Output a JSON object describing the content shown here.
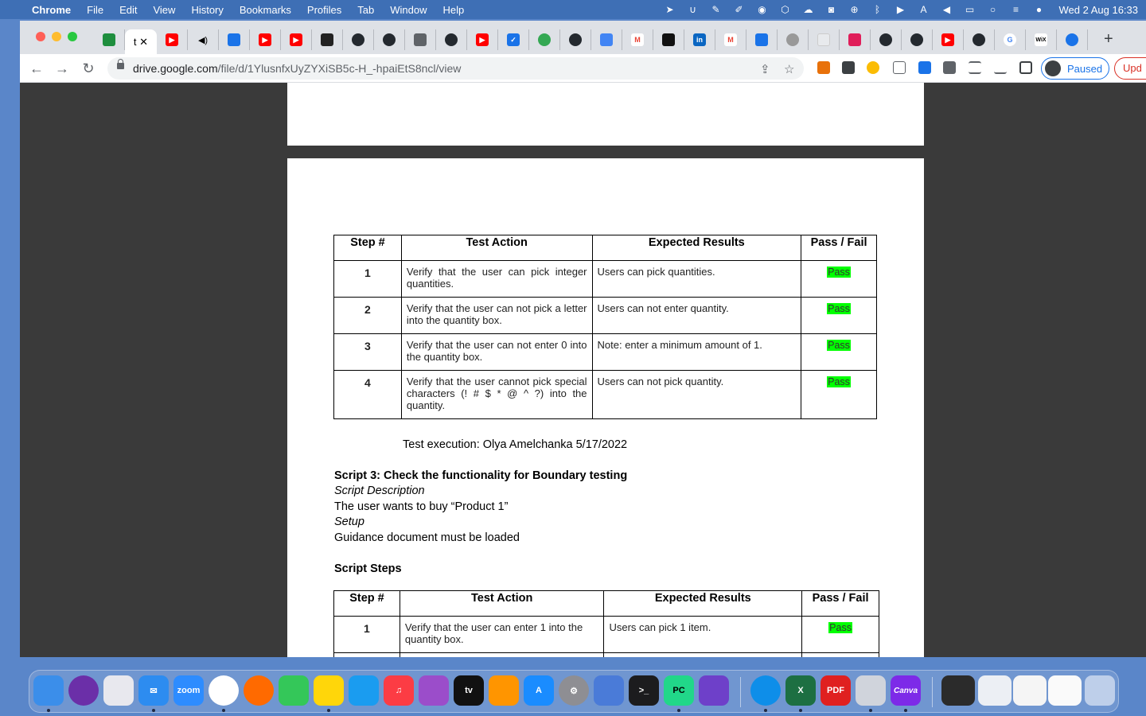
{
  "menubar": {
    "app": "Chrome",
    "items": [
      "File",
      "Edit",
      "View",
      "History",
      "Bookmarks",
      "Profiles",
      "Tab",
      "Window",
      "Help"
    ],
    "clock": "Wed 2 Aug  16:33"
  },
  "browser": {
    "active_tab_label": "t",
    "url_host": "drive.google.com",
    "url_path": "/file/d/1YlusnfxUyZYXiSB5c-H_-hpaiEtS8ncl/view",
    "profile_label": "Paused",
    "update_label": "Upd"
  },
  "doc": {
    "headers": [
      "Step #",
      "Test Action",
      "Expected Results",
      "Pass / Fail"
    ],
    "table1_rows": [
      {
        "step": "1",
        "action": "Verify that the user can pick integer quantities.",
        "expected": "Users can pick quantities.",
        "result": "Pass"
      },
      {
        "step": "2",
        "action": "Verify that the user can not pick a letter into the quantity box.",
        "expected": "Users can not enter quantity.",
        "result": "Pass"
      },
      {
        "step": "3",
        "action": "Verify that the user can not enter 0 into the quantity box.",
        "expected": "Note: enter a minimum amount of 1.",
        "result": "Pass"
      },
      {
        "step": "4",
        "action": "Verify that the user cannot pick special characters (! # $ * @ ^ ?) into the quantity.",
        "expected": "Users can not pick quantity.",
        "result": "Pass"
      }
    ],
    "test_execution": "Test execution: Olya Amelchanka 5/17/2022",
    "script3_title": "Script 3: Check the functionality for Boundary testing",
    "script_description_label": "Script Description",
    "script_description": "The user wants to buy “Product 1”",
    "setup_label": "Setup",
    "setup_text": "Guidance document must be loaded",
    "script_steps_label": "Script Steps",
    "table2_rows": [
      {
        "step": "1",
        "action": "Verify that the user can enter 1 into the quantity box.",
        "expected": "Users can pick 1 item.",
        "result": "Pass"
      }
    ]
  },
  "dock": {
    "zoom_label": "zoom",
    "tv_label": "tv",
    "pycharm_label": "PC",
    "pdf_label": "PDF",
    "canva_label": "Canva",
    "excel_label": "X"
  },
  "colors": {
    "pass_highlight": "#00ff00",
    "menubar": "#3e6fb5",
    "viewer_bg": "#3a3a3a"
  }
}
